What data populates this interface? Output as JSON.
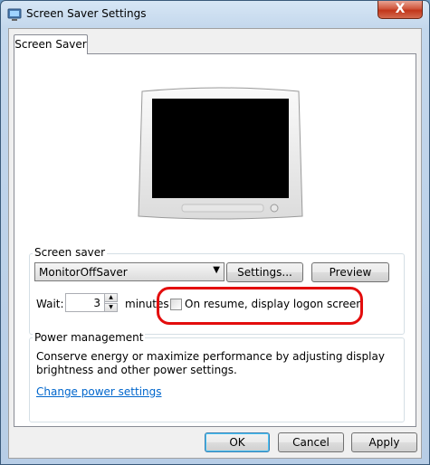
{
  "window": {
    "title": "Screen Saver Settings",
    "close_symbol": "X"
  },
  "tabs": [
    {
      "label": "Screen Saver"
    }
  ],
  "screen_saver": {
    "group_label": "Screen saver",
    "selected": "MonitorOffSaver",
    "settings_button": "Settings...",
    "preview_button": "Preview",
    "wait_label": "Wait:",
    "wait_value": "3",
    "minutes_label": "minutes",
    "logon_checkbox_label": "On resume, display logon screen",
    "logon_checked": false
  },
  "power": {
    "group_label": "Power management",
    "description_line1": "Conserve energy or maximize performance by adjusting display",
    "description_line2": "brightness and other power settings.",
    "link": "Change power settings"
  },
  "buttons": {
    "ok": "OK",
    "cancel": "Cancel",
    "apply": "Apply"
  },
  "colors": {
    "annotation": "#e30d0d",
    "link": "#0066cc",
    "close": "#c1351a"
  }
}
